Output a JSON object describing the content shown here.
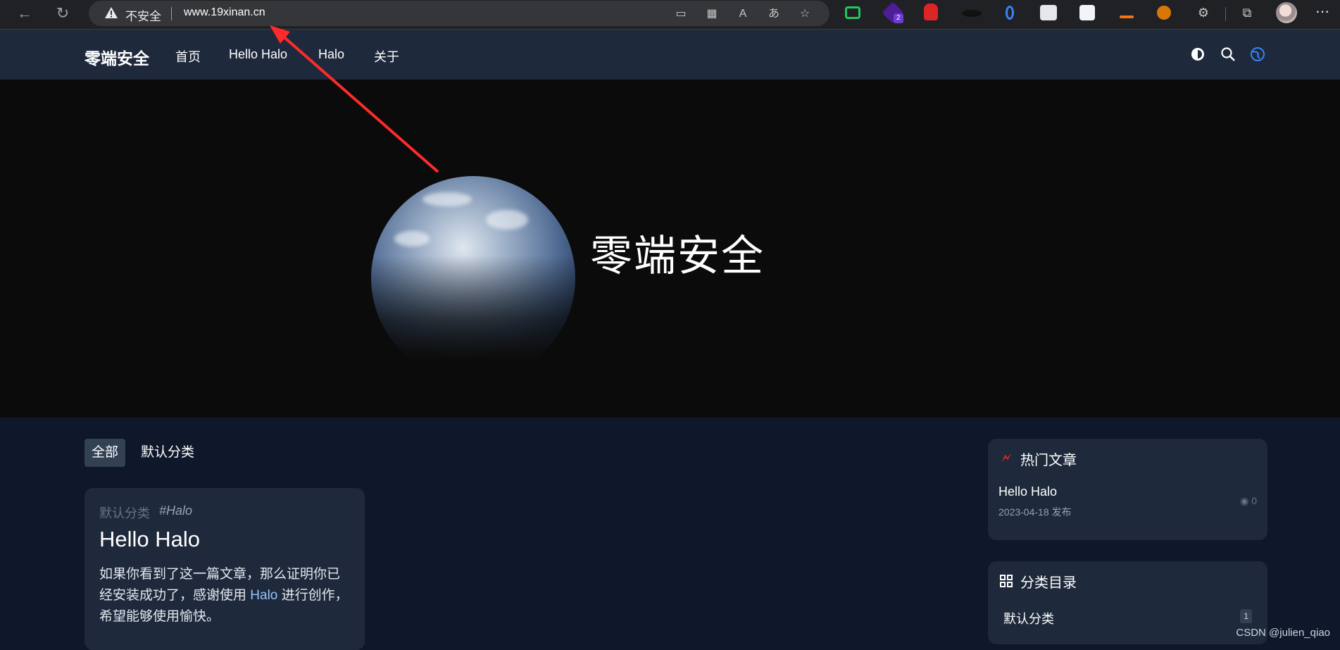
{
  "browser": {
    "security_label": "不安全",
    "url": "www.19xinan.cn",
    "extension_badge": "2"
  },
  "site": {
    "brand": "零端安全",
    "menu": [
      "首页",
      "Hello Halo",
      "Halo",
      "关于"
    ]
  },
  "hero": {
    "title": "零端安全"
  },
  "tabs": [
    "全部",
    "默认分类"
  ],
  "post": {
    "category": "默认分类",
    "tag": "#Halo",
    "title": "Hello Halo",
    "excerpt_start": "如果你看到了这一篇文章，那么证明你已经安装成功了，感谢使用 ",
    "excerpt_link": "Halo",
    "excerpt_end": " 进行创作，希望能够使用愉快。"
  },
  "hot_widget": {
    "title": "热门文章",
    "item_title": "Hello Halo",
    "item_date": "2023-04-18 发布",
    "item_views": "0"
  },
  "category_widget": {
    "title": "分类目录",
    "item_name": "默认分类",
    "item_count": "1"
  },
  "watermark": "CSDN @julien_qiao",
  "colors": {
    "accent_blue": "#3b82f6",
    "annotation_red": "#ff2a2a",
    "hot_red": "#dc2626"
  }
}
